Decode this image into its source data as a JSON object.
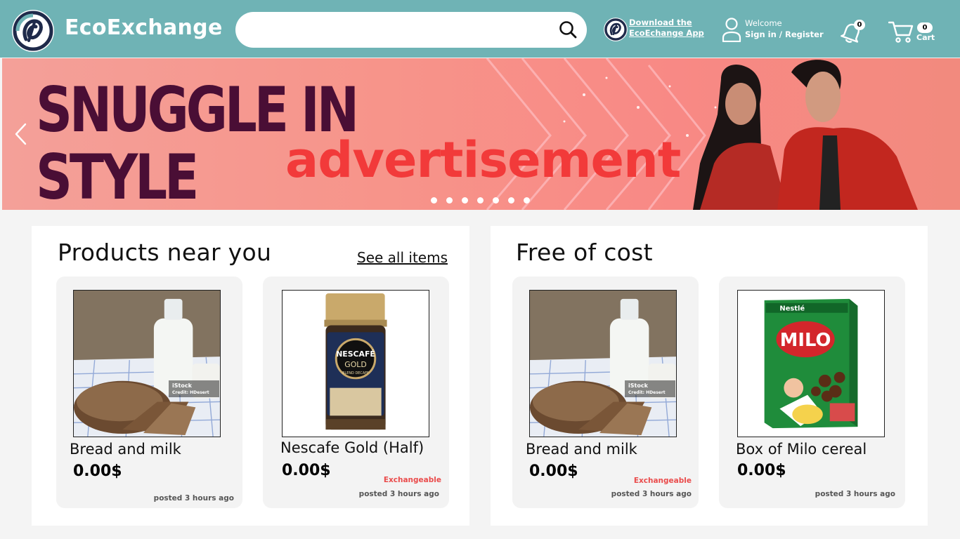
{
  "header": {
    "brand": "EcoExchange",
    "search_placeholder": "",
    "app_download_line1": "Download the",
    "app_download_line2": "EcoEchange App",
    "welcome": "Welcome",
    "signin": "Sign in / Register",
    "notification_count": "0",
    "cart_count": "0",
    "cart_label": "Cart",
    "colors": {
      "bar": "#6fb3b5",
      "logo_ring": "#1f2a4a"
    }
  },
  "banner": {
    "headline_line1": "SNUGGLE IN",
    "headline_line2": "STYLE",
    "ad_label": "advertisement",
    "dot_count": 7,
    "icons": {
      "prev": "chevron-left-icon"
    }
  },
  "sections": {
    "near": {
      "title": "Products near you",
      "see_all": "See all items",
      "items": [
        {
          "name": "Bread and milk",
          "price": "0.00$",
          "exchangeable": "",
          "posted": "posted 3 hours ago",
          "image": "bread-milk"
        },
        {
          "name": "Nescafe Gold (Half)",
          "price": "0.00$",
          "exchangeable": "Exchangeable",
          "posted": "posted 3 hours ago",
          "image": "nescafe"
        }
      ]
    },
    "free": {
      "title": "Free of cost",
      "items": [
        {
          "name": "Bread and milk",
          "price": "0.00$",
          "exchangeable": "Exchangeable",
          "posted": "posted 3 hours ago",
          "image": "bread-milk"
        },
        {
          "name": "Box of Milo cereal",
          "price": "0.00$",
          "exchangeable": "",
          "posted": "posted 3 hours ago",
          "image": "milo"
        }
      ]
    }
  },
  "watermark": {
    "line1": "iStock",
    "line2": "Credit: HDesert"
  },
  "product_text": {
    "nescafe_brand": "NESCAFÉ",
    "nescafe_variant": "GOLD",
    "nescafe_sub": "BLEND DECAFF",
    "milo_brand": "Nestlé",
    "milo_name": "MILO"
  }
}
